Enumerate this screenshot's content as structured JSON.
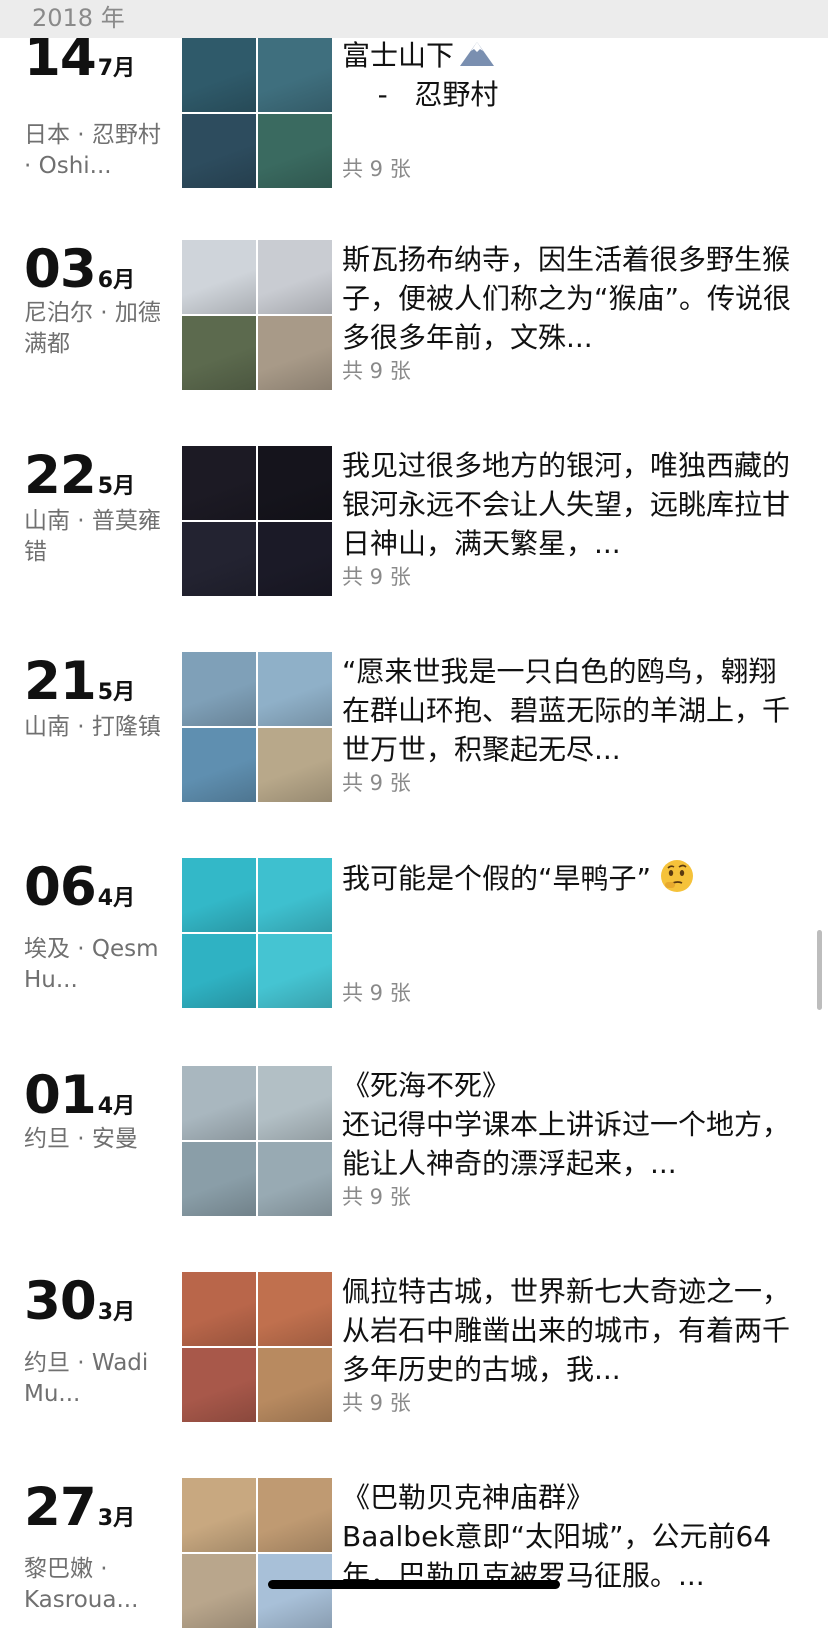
{
  "header": {
    "year": "2018 年"
  },
  "colors": {
    "background": "#ffffff",
    "header_bg": "#ececec",
    "secondary_text": "#707070",
    "count_text": "#8a8a8a"
  },
  "entries": [
    {
      "day": "14",
      "month": "7月",
      "location": "日本 · 忍野村 · Oshi...",
      "caption": "富士山下",
      "caption_line2": "    -   忍野村",
      "caption_emoji": "mountain-emoji",
      "count": "共 9 张",
      "thumbs": [
        "#2f5a6a",
        "#3f6f7e",
        "#2d4c5e",
        "#3a6a60"
      ]
    },
    {
      "day": "03",
      "month": "6月",
      "location": "尼泊尔 · 加德满都",
      "caption": "斯瓦扬布纳寺，因生活着很多野生猴子，便被人们称之为“猴庙”。传说很多很多年前，文殊...",
      "count": "共 9 张",
      "thumbs": [
        "#cfd4da",
        "#c9ccd2",
        "#5c6a4e",
        "#a89a88"
      ]
    },
    {
      "day": "22",
      "month": "5月",
      "location": "山南 · 普莫雍错",
      "caption": "我见过很多地方的银河，唯独西藏的银河永远不会让人失望，远眺库拉甘日神山，满天繁星，...",
      "count": "共 9 张",
      "thumbs": [
        "#1c1a24",
        "#15141c",
        "#232331",
        "#1b1a27"
      ]
    },
    {
      "day": "21",
      "month": "5月",
      "location": "山南 · 打隆镇",
      "caption": "“愿来世我是一只白色的鸥鸟，翱翔在群山环抱、碧蓝无际的羊湖上，千世万世，积聚起无尽...",
      "count": "共 9 张",
      "thumbs": [
        "#7fa0b8",
        "#8fb0c8",
        "#5f8fb0",
        "#b8a88a"
      ]
    },
    {
      "day": "06",
      "month": "4月",
      "location": "埃及 · Qesm Hu...",
      "caption": "我可能是个假的“旱鸭子”",
      "caption_emoji": "thinking-face-emoji",
      "count": "共 9 张",
      "thumbs": [
        "#33b8c8",
        "#3ec0cf",
        "#2fb2c3",
        "#45c4d2"
      ]
    },
    {
      "day": "01",
      "month": "4月",
      "location": "约旦 · 安曼",
      "caption": "《死海不死》\n还记得中学课本上讲诉过一个地方，能让人神奇的漂浮起来，...",
      "count": "共 9 张",
      "thumbs": [
        "#a9b7bf",
        "#b2bfc5",
        "#8a9ea8",
        "#98aab3"
      ]
    },
    {
      "day": "30",
      "month": "3月",
      "location": "约旦 · Wadi Mu...",
      "caption": "佩拉特古城，世界新七大奇迹之一，从岩石中雕凿出来的城市，有着两千多年历史的古城，我...",
      "count": "共 9 张",
      "thumbs": [
        "#b9664a",
        "#c0704e",
        "#a8584a",
        "#b88a60"
      ]
    },
    {
      "day": "27",
      "month": "3月",
      "location": "黎巴嫩 · Kasroua...",
      "caption": "《巴勒贝克神庙群》\nBaalbek意即“太阳城”，公元前64年，巴勒贝克被罗马征服。...",
      "count": "",
      "thumbs": [
        "#c8a880",
        "#bf9a72",
        "#b9a68c",
        "#a8c0d8"
      ]
    }
  ]
}
